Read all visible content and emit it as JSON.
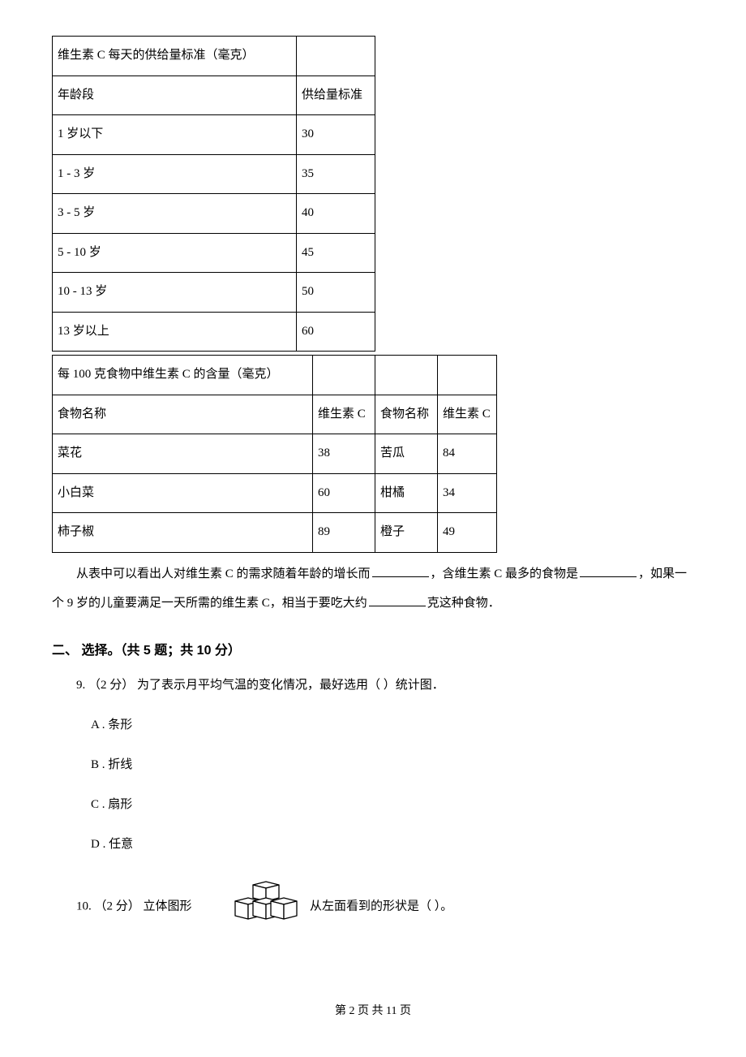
{
  "table1": {
    "title": "维生素 C 每天的供给量标准（毫克）",
    "header_col1": "年龄段",
    "header_col2": "供给量标准",
    "rows": [
      {
        "age": "1 岁以下",
        "amount": "30"
      },
      {
        "age": "1 - 3 岁",
        "amount": "35"
      },
      {
        "age": "3 - 5 岁",
        "amount": "40"
      },
      {
        "age": "5 - 10 岁",
        "amount": "45"
      },
      {
        "age": "10 - 13 岁",
        "amount": "50"
      },
      {
        "age": "13 岁以上",
        "amount": "60"
      }
    ]
  },
  "table2": {
    "title": "每 100 克食物中维生素 C 的含量（毫克）",
    "header_col1": "食物名称",
    "header_col2": "维生素 C",
    "header_col3": "食物名称",
    "header_col4": "维生素 C",
    "rows": [
      {
        "n1": "菜花",
        "v1": "38",
        "n2": "苦瓜",
        "v2": "84"
      },
      {
        "n1": "小白菜",
        "v1": "60",
        "n2": "柑橘",
        "v2": "34"
      },
      {
        "n1": "柿子椒",
        "v1": "89",
        "n2": "橙子",
        "v2": "49"
      }
    ]
  },
  "analysis": {
    "part1": "从表中可以看出人对维生素 C 的需求随着年龄的增长而",
    "part2": "，含维生素 C 最多的食物是",
    "part3": "，如果一个 9 岁的儿童要满足一天所需的维生素 C，相当于要吃大约",
    "part4": "克这种食物．"
  },
  "section2_title": "二、 选择。（共 5 题；共 10 分）",
  "q9": {
    "stem": "9. （2 分） 为了表示月平均气温的变化情况，最好选用（    ）统计图．",
    "A": "A .  条形",
    "B": "B .  折线",
    "C": "C .  扇形",
    "D": "D .  任意"
  },
  "q10": {
    "pre": "10. （2 分） 立体图形",
    "post": " 从左面看到的形状是（    ）。"
  },
  "footer": "第 2 页 共 11 页"
}
